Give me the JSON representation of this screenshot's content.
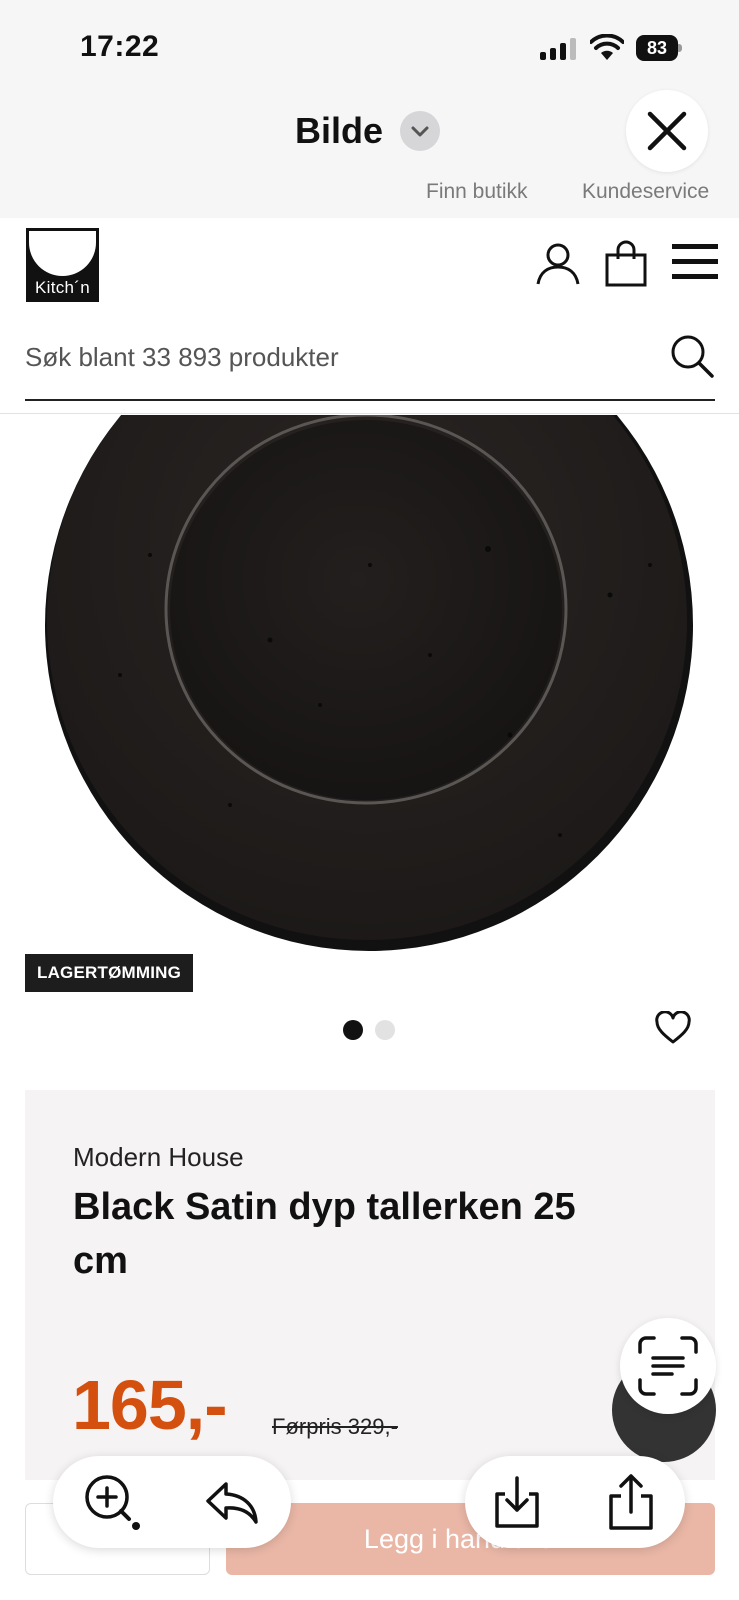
{
  "status_bar": {
    "time": "17:22",
    "battery": "83"
  },
  "preview": {
    "title": "Bilde"
  },
  "top_links": {
    "find_store": "Finn butikk",
    "customer_service": "Kundeservice"
  },
  "logo": {
    "text": "Kitch´n"
  },
  "search": {
    "placeholder": "Søk blant 33 893 produkter"
  },
  "product": {
    "badge": "LAGERTØMMING",
    "brand": "Modern House",
    "title": "Black Satin dyp tallerken 25 cm",
    "price": "165,-",
    "old_price": "Førpris 329,-",
    "image_count": 2,
    "current_image": 1
  },
  "purchase": {
    "add_to_cart": "Legg i handlekurv"
  },
  "colors": {
    "price": "#d4500f",
    "cta": "#eab7a6",
    "badge": "#1d1d1d"
  }
}
